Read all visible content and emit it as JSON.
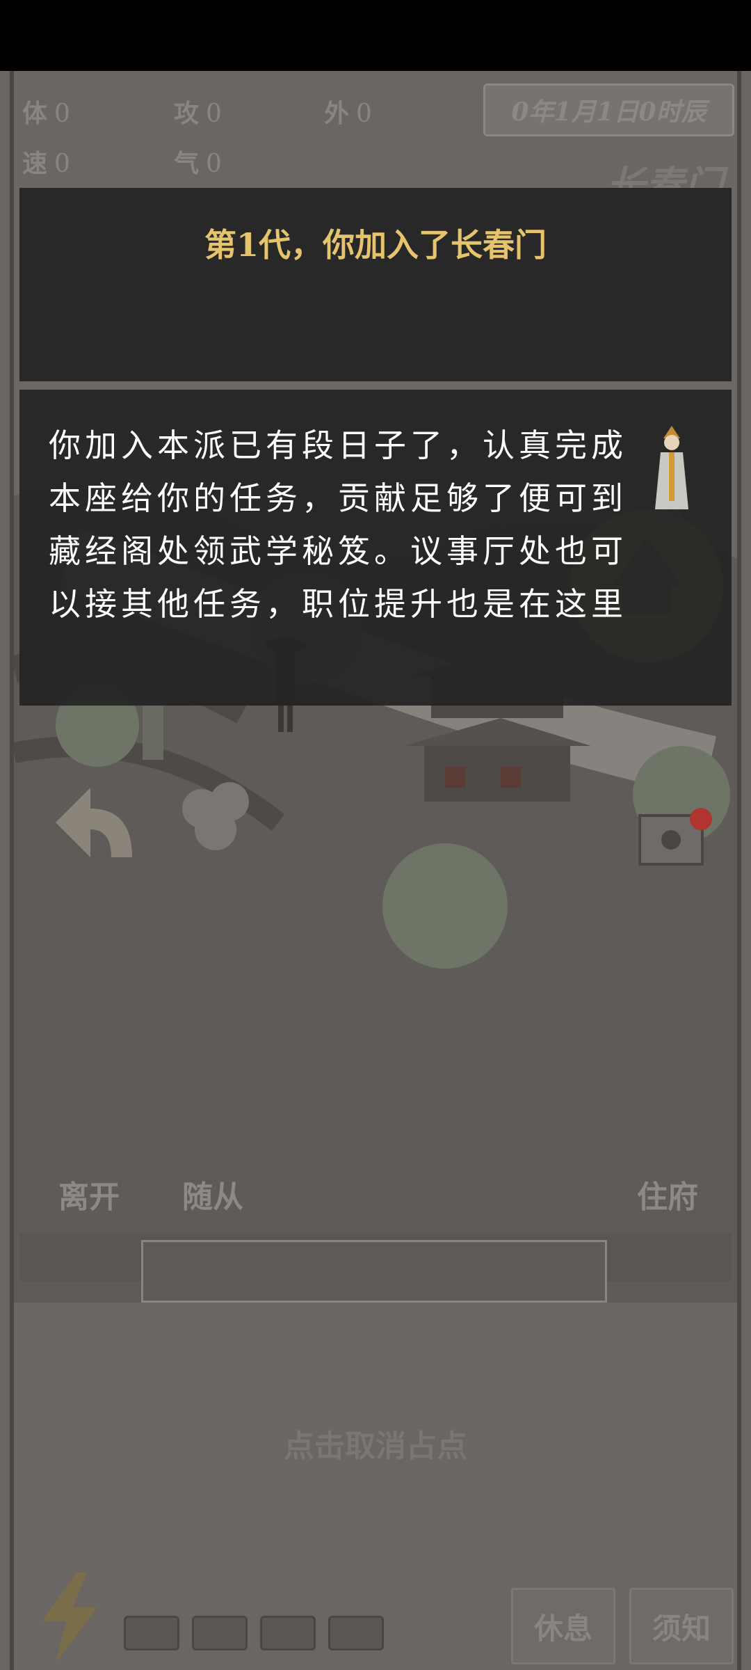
{
  "stats": [
    {
      "label": "体",
      "value": "0"
    },
    {
      "label": "攻",
      "value": "0"
    },
    {
      "label": "外",
      "value": "0"
    },
    {
      "label": "速",
      "value": "0"
    },
    {
      "label": "气",
      "value": "0"
    }
  ],
  "date": "0年1月1日0时辰",
  "sect_name": "长春门",
  "dialog": {
    "title": "第1代，你加入了长春门",
    "body": "你加入本派已有段日子了，认真完成本座给你的任务，贡献足够了便可到藏经阁处领武学秘笈。议事厅处也可以接其他任务，职位提升也是在这里"
  },
  "actions": {
    "leave": "离开",
    "followers": "随从",
    "residence": "住府"
  },
  "cancel_hint": "点击取消占点",
  "buttons": {
    "rest": "休息",
    "notice": "须知"
  },
  "colors": {
    "title_gold": "#e6c36d",
    "panel_dark": "#232323",
    "notify_dot": "#b0342f"
  }
}
